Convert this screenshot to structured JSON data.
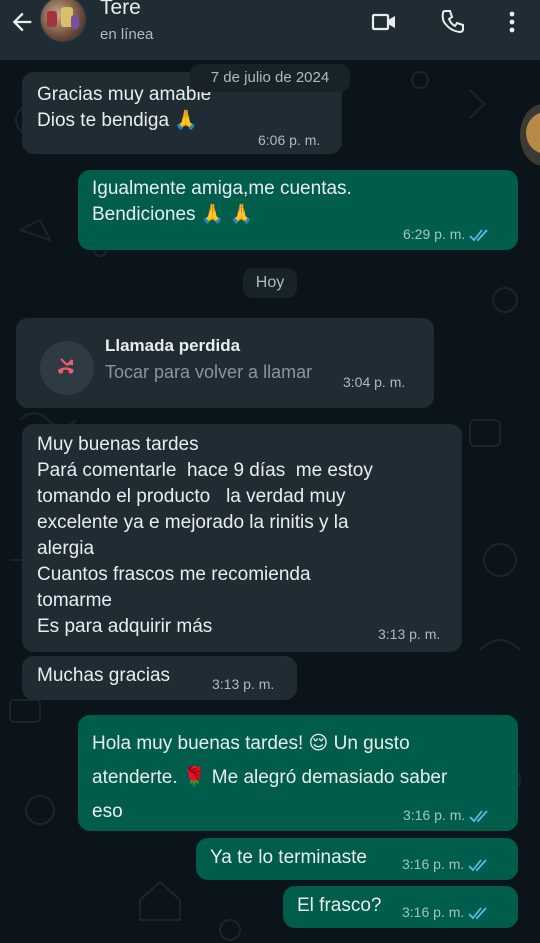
{
  "header": {
    "contact_name": "Tere",
    "status": "en línea"
  },
  "date_chips": {
    "first": "7 de julio de 2024",
    "today": "Hoy"
  },
  "messages": [
    {
      "dir": "in",
      "lines": "Gracias muy amable\nDios te bendiga 🙏",
      "time": "6:06 p. m."
    },
    {
      "dir": "out",
      "lines": "Igualmente amiga,me cuentas.\nBendiciones 🙏 🙏",
      "time": "6:29 p. m.",
      "read": true
    },
    {
      "dir": "in",
      "lines": "Muy buenas tardes\nPará comentarle  hace 9 días  me estoy\ntomando el producto   la verdad muy\nexcelente ya e mejorado la rinitis y la\nalergia\nCuantos frascos me recomienda\ntomarme\nEs para adquirir más",
      "time": "3:13 p. m."
    },
    {
      "dir": "in",
      "lines": "Muchas gracias",
      "time": "3:13 p. m."
    },
    {
      "dir": "out",
      "lines": "Hola muy buenas tardes! 😌 Un gusto\natenderte. 🌹 Me alegró demasiado saber\neso",
      "time": "3:16 p. m.",
      "read": true
    },
    {
      "dir": "out",
      "lines": "Ya te lo terminaste",
      "time": "3:16 p. m.",
      "read": true
    },
    {
      "dir": "out",
      "lines": "El frasco?",
      "time": "3:16 p. m.",
      "read": true
    }
  ],
  "missed_call": {
    "title": "Llamada perdida",
    "subtitle": "Tocar para volver a llamar",
    "time": "3:04 p. m."
  },
  "colors": {
    "background": "#0b141a",
    "header": "#1f2c34",
    "incoming_bubble": "#202c33",
    "outgoing_bubble": "#005c4b",
    "read_ticks": "#53bdeb",
    "missed_call_red": "#f15c6d"
  },
  "icons": [
    "back-arrow-icon",
    "video-call-icon",
    "phone-icon",
    "more-options-icon",
    "missed-call-icon",
    "read-ticks-icon",
    "praying-hands-emoji",
    "relieved-face-emoji",
    "rose-emoji"
  ]
}
